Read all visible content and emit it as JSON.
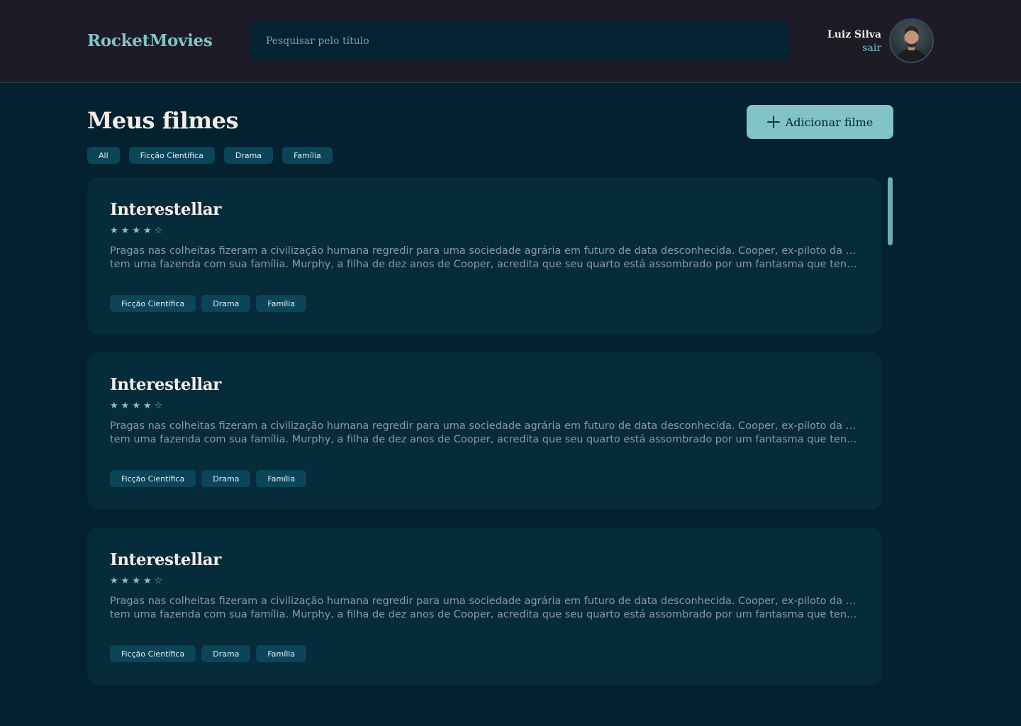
{
  "app": {
    "logo": "RocketMovies"
  },
  "search": {
    "placeholder": "Pesquisar pelo título"
  },
  "profile": {
    "name": "Luiz Silva",
    "logout": "sair"
  },
  "page": {
    "title": "Meus filmes",
    "add_label": "Adicionar filme"
  },
  "filters": [
    "All",
    "Ficção Científica",
    "Drama",
    "Família"
  ],
  "movies": [
    {
      "title": "Interestellar",
      "rating": 4,
      "rating_max": 5,
      "description_line1": "Pragas nas colheitas fizeram a civilização humana regredir para uma sociedade agrária em futuro de data desconhecida. Cooper, ex-piloto da NASA,",
      "description_line2": "tem uma fazenda com sua família. Murphy, a filha de dez anos de Cooper, acredita que seu quarto está assombrado por um fantasma que tenta se...",
      "tags": [
        "Ficção Científica",
        "Drama",
        "Família"
      ]
    },
    {
      "title": "Interestellar",
      "rating": 4,
      "rating_max": 5,
      "description_line1": "Pragas nas colheitas fizeram a civilização humana regredir para uma sociedade agrária em futuro de data desconhecida. Cooper, ex-piloto da NASA,",
      "description_line2": "tem uma fazenda com sua família. Murphy, a filha de dez anos de Cooper, acredita que seu quarto está assombrado por um fantasma que tenta se...",
      "tags": [
        "Ficção Científica",
        "Drama",
        "Família"
      ]
    },
    {
      "title": "Interestellar",
      "rating": 4,
      "rating_max": 5,
      "description_line1": "Pragas nas colheitas fizeram a civilização humana regredir para uma sociedade agrária em futuro de data desconhecida. Cooper, ex-piloto da NASA,",
      "description_line2": "tem uma fazenda com sua família. Murphy, a filha de dez anos de Cooper, acredita que seu quarto está assombrado por um fantasma que tenta se...",
      "tags": [
        "Ficção Científica",
        "Drama",
        "Família"
      ]
    }
  ],
  "colors": {
    "accent": "#82c3c9",
    "background": "#04212f",
    "header": "#1c1b26",
    "card": "#062b3b",
    "chip": "#0b4559"
  },
  "icons": {
    "add": "plus-icon",
    "star_filled": "star-filled-icon",
    "star_empty": "star-empty-icon",
    "avatar": "user-photo"
  }
}
